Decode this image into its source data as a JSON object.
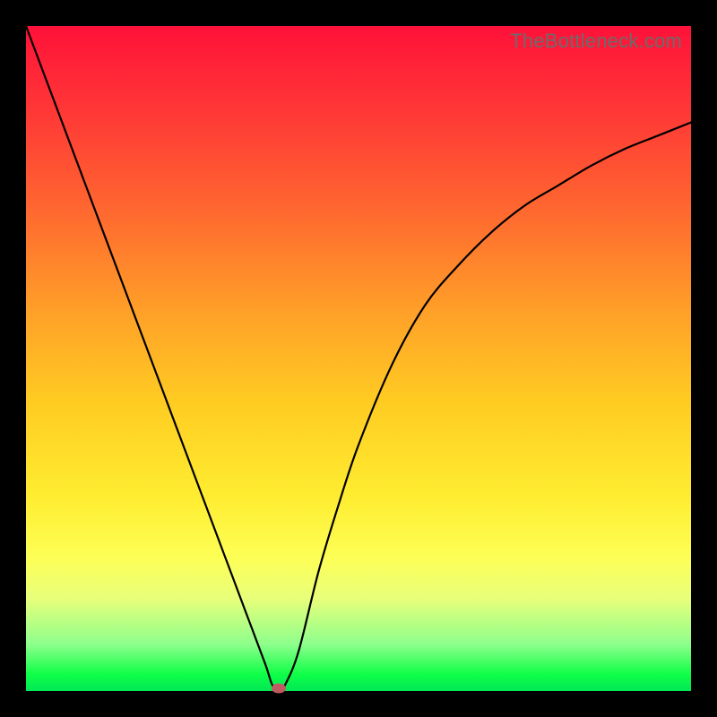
{
  "watermark": "TheBottleneck.com",
  "chart_data": {
    "type": "line",
    "title": "",
    "xlabel": "",
    "ylabel": "",
    "xlim": [
      0,
      100
    ],
    "ylim": [
      0,
      100
    ],
    "x": [
      0,
      3,
      6,
      9,
      12,
      15,
      18,
      21,
      24,
      27,
      30,
      33,
      36,
      37,
      38,
      39,
      41,
      44,
      47,
      50,
      55,
      60,
      65,
      70,
      75,
      80,
      85,
      90,
      95,
      100
    ],
    "values": [
      100,
      92,
      84,
      76,
      68,
      60,
      52,
      44,
      36,
      28,
      20,
      12,
      4,
      1,
      0,
      1,
      6,
      18,
      28,
      37,
      49,
      58,
      64,
      69,
      73,
      76,
      79,
      81.5,
      83.5,
      85.5
    ],
    "optimum": {
      "x": 38,
      "y": 0
    },
    "background_gradient": {
      "top_color": "#ff1139",
      "bottom_color": "#00e756",
      "meaning": "red=high bottleneck, green=no bottleneck"
    }
  }
}
